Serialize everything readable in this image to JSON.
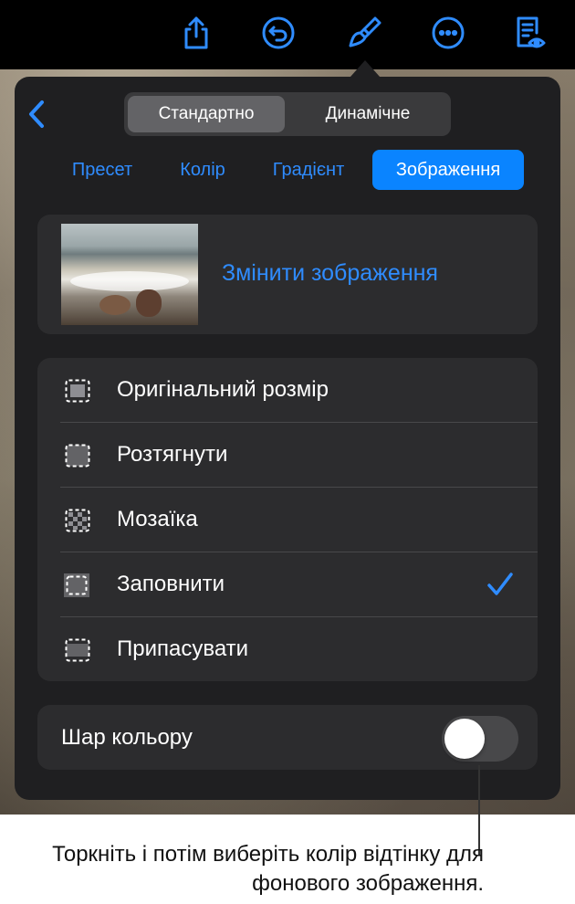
{
  "toolbar": {
    "icons": [
      "share-icon",
      "undo-icon",
      "format-brush-icon",
      "more-icon",
      "reader-view-icon"
    ],
    "accent": "#2f8cff"
  },
  "segmented": {
    "options": [
      "Стандартно",
      "Динамічне"
    ],
    "selected": "Стандартно"
  },
  "tabs": {
    "items": [
      "Пресет",
      "Колір",
      "Градієнт",
      "Зображення"
    ],
    "selected": "Зображення"
  },
  "image_card": {
    "change_label": "Змінити зображення"
  },
  "fill_options": {
    "items": [
      "Оригінальний розмір",
      "Розтягнути",
      "Мозаїка",
      "Заповнити",
      "Припасувати"
    ],
    "selected": "Заповнити"
  },
  "color_layer": {
    "label": "Шар кольору",
    "enabled": false
  },
  "callout": {
    "text": "Торкніть і потім виберіть колір відтінку для фонового зображення."
  },
  "colors": {
    "popover_bg": "#1f1f21",
    "card_bg": "#2c2c2e",
    "active_tab": "#0a84ff"
  }
}
